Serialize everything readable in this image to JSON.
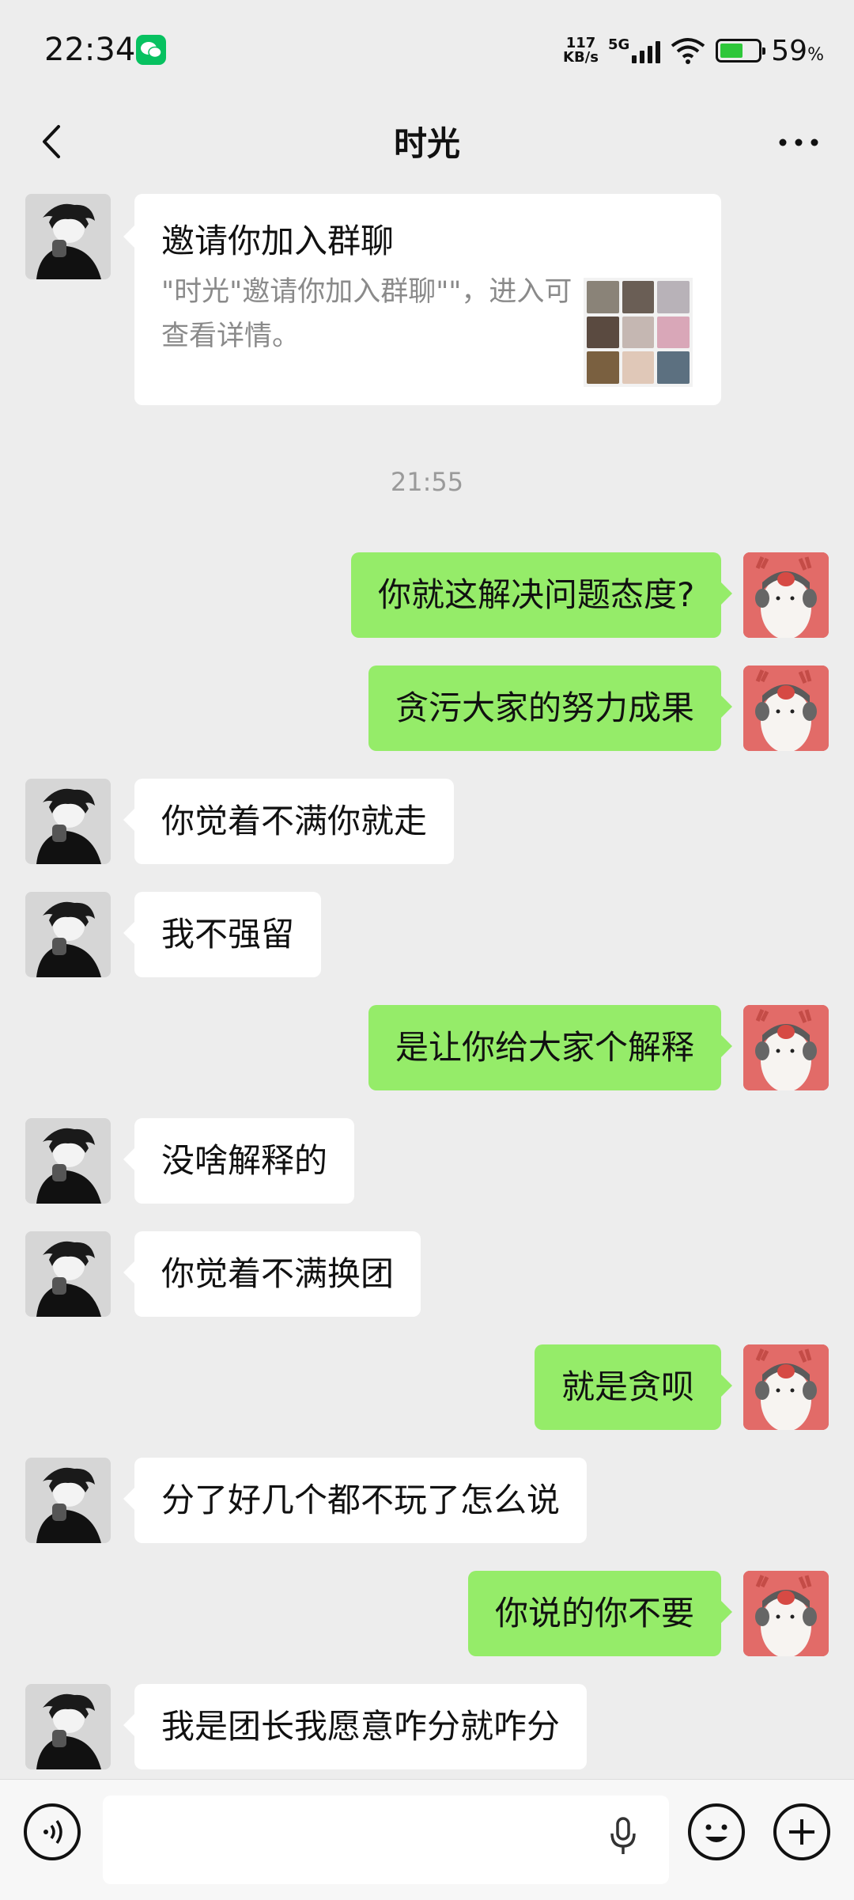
{
  "status_bar": {
    "time": "22:34",
    "net_speed_value": "117",
    "net_speed_unit": "KB/s",
    "network_type": "5G",
    "battery_percent": "59",
    "battery_unit": "%"
  },
  "header": {
    "title": "时光"
  },
  "invite_card": {
    "title": "邀请你加入群聊",
    "description": "\"时光\"邀请你加入群聊\"\"，进入可查看详情。"
  },
  "timestamp": "21:55",
  "messages": [
    {
      "side": "me",
      "text": "你就这解决问题态度?"
    },
    {
      "side": "me",
      "text": "贪污大家的努力成果"
    },
    {
      "side": "other",
      "text": "你觉着不满你就走"
    },
    {
      "side": "other",
      "text": "我不强留"
    },
    {
      "side": "me",
      "text": "是让你给大家个解释"
    },
    {
      "side": "other",
      "text": "没啥解释的"
    },
    {
      "side": "other",
      "text": "你觉着不满换团"
    },
    {
      "side": "me",
      "text": "就是贪呗"
    },
    {
      "side": "other",
      "text": "分了好几个都不玩了怎么说"
    },
    {
      "side": "me",
      "text": "你说的你不要"
    },
    {
      "side": "other",
      "text": "我是团长我愿意咋分就咋分"
    }
  ],
  "input_bar": {
    "text_value": ""
  },
  "colors": {
    "background": "#EDEDED",
    "my_bubble": "#95EC69",
    "other_bubble": "#FFFFFF",
    "brand_green": "#07C160"
  },
  "icons": {
    "back": "back-arrow-icon",
    "more": "more-dots-icon",
    "voice": "voice-mode-icon",
    "mic": "microphone-icon",
    "emoji": "emoji-icon",
    "plus": "plus-icon"
  }
}
